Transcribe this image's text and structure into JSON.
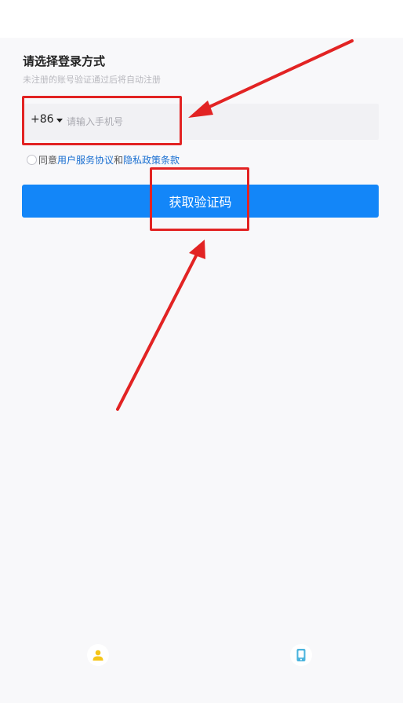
{
  "login": {
    "title": "请选择登录方式",
    "subtitle": "未注册的账号验证通过后将自动注册",
    "country_code": "+86",
    "phone_placeholder": "请输入手机号",
    "phone_value": "",
    "agreement": {
      "prefix": "同意",
      "terms_link": "用户服务协议",
      "conjunction": "和",
      "privacy_link": "隐私政策条款",
      "checked": false
    },
    "get_code_button": "获取验证码"
  },
  "bottom_icons": {
    "left": "person-icon",
    "right": "phone-icon"
  },
  "colors": {
    "primary_button": "#1386f8",
    "link": "#1a6fd1",
    "annotation": "#e22323",
    "account_icon": "#f5c518",
    "device_icon": "#4bb4de"
  }
}
